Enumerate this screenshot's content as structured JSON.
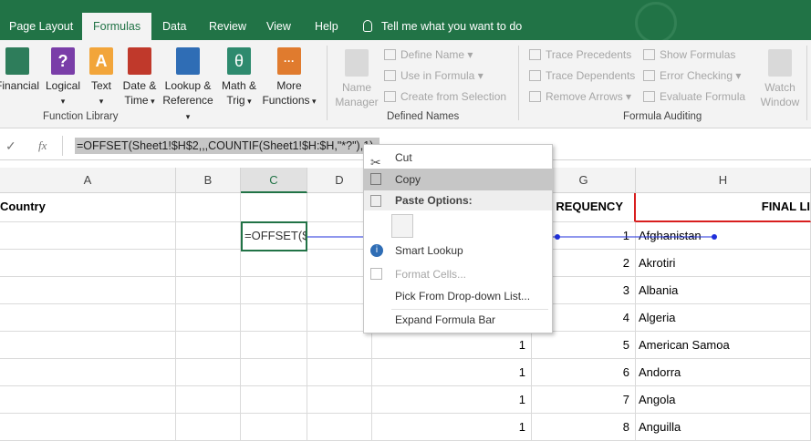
{
  "tabs": [
    "Page Layout",
    "Formulas",
    "Data",
    "Review",
    "View",
    "Help"
  ],
  "active_tab": "Formulas",
  "tell_me": "Tell me what you want to do",
  "function_library": {
    "label": "Function Library",
    "buttons": [
      {
        "l1": "Financial",
        "l2": "",
        "color": "#2e7d5b"
      },
      {
        "l1": "Logical",
        "l2": "",
        "color": "#7a3ea8"
      },
      {
        "l1": "Text",
        "l2": "",
        "color": "#f2a53a"
      },
      {
        "l1": "Date &",
        "l2": "Time",
        "color": "#c0392b"
      },
      {
        "l1": "Lookup &",
        "l2": "Reference",
        "color": "#2f6db5"
      },
      {
        "l1": "Math &",
        "l2": "Trig",
        "color": "#2e8a6e"
      },
      {
        "l1": "More",
        "l2": "Functions",
        "color": "#e07b2e"
      }
    ]
  },
  "name_manager": {
    "l1": "Name",
    "l2": "Manager"
  },
  "defined_names": {
    "label": "Defined Names",
    "items": [
      "Define Name",
      "Use in Formula",
      "Create from Selection"
    ]
  },
  "formula_auditing": {
    "label": "Formula Auditing",
    "items": [
      "Trace Precedents",
      "Trace Dependents",
      "Remove Arrows",
      "Show Formulas",
      "Error Checking",
      "Evaluate Formula"
    ],
    "watch": {
      "l1": "Watch",
      "l2": "Window"
    }
  },
  "formula_bar": {
    "check": "✓",
    "fx": "fx",
    "text": "=OFFSET(Sheet1!$H$2,,,COUNTIF(Sheet1!$H:$H,\"*?\"),1)"
  },
  "columns": [
    "A",
    "B",
    "C",
    "D",
    "G",
    "H"
  ],
  "selected_column": "C",
  "header_row": {
    "a": "Country",
    "g": "REQUENCY",
    "h": "FINAL  LI"
  },
  "active_cell_text": "=OFFSET($",
  "rows": [
    {
      "f": "",
      "g": "1",
      "h": "Afghanistan"
    },
    {
      "f": "",
      "g": "2",
      "h": "Akrotiri"
    },
    {
      "f": "",
      "g": "3",
      "h": "Albania"
    },
    {
      "f": "",
      "g": "4",
      "h": "Algeria"
    },
    {
      "f": "1",
      "g": "5",
      "h": "American  Samoa"
    },
    {
      "f": "1",
      "g": "6",
      "h": "Andorra"
    },
    {
      "f": "1",
      "g": "7",
      "h": "Angola"
    },
    {
      "f": "1",
      "g": "8",
      "h": "Anguilla"
    }
  ],
  "context_menu": {
    "cut": "Cut",
    "copy": "Copy",
    "paste_options": "Paste Options:",
    "smart_lookup": "Smart Lookup",
    "format_cells": "Format Cells...",
    "pick_list": "Pick From Drop-down List...",
    "expand": "Expand Formula Bar"
  },
  "colors": {
    "excel_green": "#217346",
    "trace_blue": "#1f2fdb",
    "header_red": "#d81e1e"
  }
}
